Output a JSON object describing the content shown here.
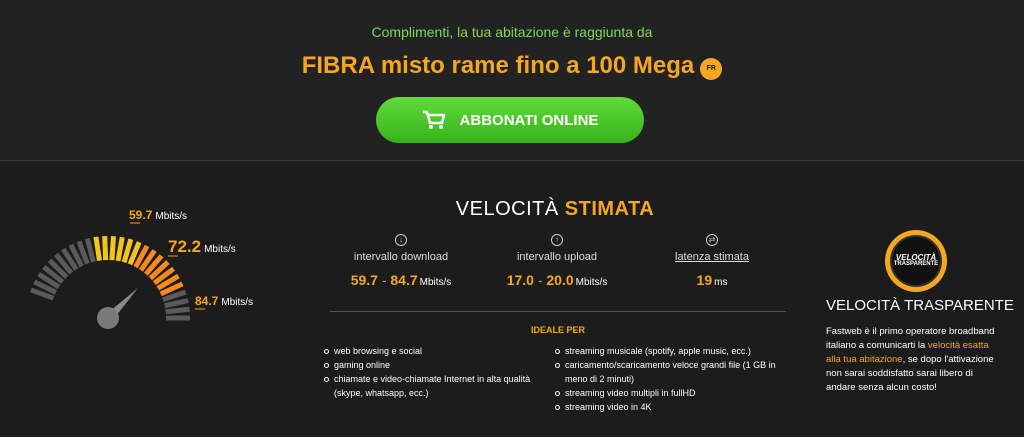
{
  "header": {
    "congrats": "Complimenti, la tua abitazione è raggiunta da",
    "technology": "FIBRA misto rame fino a 100 Mega",
    "badge_text": "FR",
    "cta_label": "ABBONATI ONLINE"
  },
  "gauge": {
    "low_value": "59.7",
    "mid_value": "72.2",
    "high_value": "84.7",
    "unit": "Mbits/s"
  },
  "speed": {
    "title_a": "VELOCITÀ ",
    "title_b": "STIMATA",
    "download": {
      "label": "intervallo download",
      "min": "59.7",
      "sep": " - ",
      "max": "84.7",
      "unit": "Mbits/s"
    },
    "upload": {
      "label": "intervallo upload",
      "min": "17.0",
      "sep": " - ",
      "max": "20.0",
      "unit": "Mbits/s"
    },
    "latency": {
      "label": "latenza stimata",
      "value": "19",
      "unit": "ms"
    }
  },
  "ideal": {
    "title": "IDEALE PER",
    "left": [
      "web browsing e social",
      "gaming online",
      "chiamate e video-chiamate Internet in alta qualità (skype, whatsapp, ecc.)"
    ],
    "right": [
      "streaming musicale (spotify, apple music, ecc.)",
      "caricamento/scaricamento veloce grandi file (1 GB in meno di 2 minuti)",
      "streaming video multipli in fullHD",
      "streaming video in 4K"
    ]
  },
  "transparency": {
    "seal_line1": "VELOCITÀ",
    "seal_line2": "TRASPARENTE",
    "title": "VELOCITÀ TRASPARENTE",
    "text_a": "Fastweb è il primo operatore broadband italiano a comunicarti la ",
    "text_hl": "velocità esatta alla tua abitazione",
    "text_b": ", se dopo l'attivazione non sarai soddisfatto sarai libero di andare senza alcun costo!"
  },
  "colors": {
    "accent": "#f5a623",
    "green": "#7ed957",
    "cta": "#46c42a",
    "bg": "#1c1c1c"
  },
  "icons": [
    "cart-icon",
    "download-icon",
    "upload-icon",
    "latency-icon"
  ]
}
